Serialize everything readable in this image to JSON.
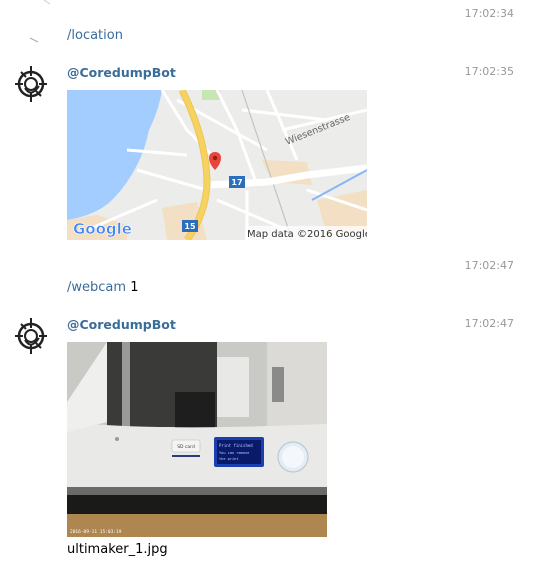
{
  "messages": [
    {
      "time": "17:02:34",
      "command": "/location",
      "args": ""
    },
    {
      "time": "17:02:35",
      "sender": "@CoredumpBot"
    },
    {
      "time": "17:02:47",
      "command": "/webcam",
      "args": "1"
    },
    {
      "time": "17:02:47",
      "sender": "@CoredumpBot"
    }
  ],
  "map": {
    "logo": "Google",
    "attribution": "Map data ©2016 Google",
    "street": "Wiesenstrasse",
    "route_17": "17",
    "route_15": "15"
  },
  "photo": {
    "filename": "ultimaker_1.jpg",
    "screen_line1": "Print finished",
    "screen_line2": "You can remove",
    "screen_line3": "the print",
    "panel_label": "SD card",
    "timestamp_overlay": "2016-09-11 15:03:19"
  },
  "colors": {
    "link": "#3a6d99",
    "timestamp": "#999999",
    "water": "#a3ccff",
    "road_major": "#f7d25e"
  }
}
